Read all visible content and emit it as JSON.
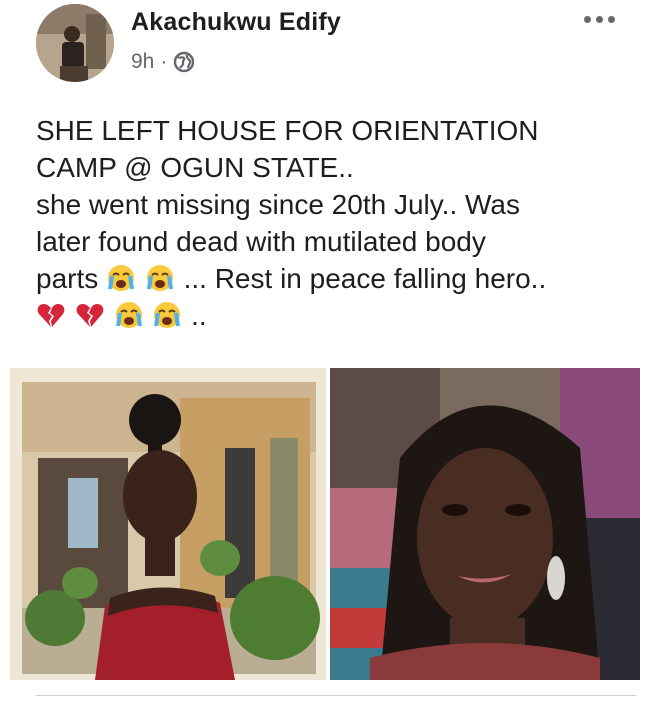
{
  "post": {
    "author": "Akachukwu Edify",
    "time": "9h",
    "separator": "·",
    "privacy_icon": "globe-icon",
    "more_icon": "more-options-icon",
    "text_lines": [
      "SHE LEFT HOUSE FOR ORIENTATION",
      "CAMP @ OGUN STATE..",
      "she went missing since 20th July.. Was",
      "later found dead with mutilated body",
      "parts",
      "... Rest in peace falling hero..",
      ".."
    ],
    "emojis": {
      "crying": "loudly-crying-face",
      "broken_heart": "broken-heart"
    },
    "photos": [
      {
        "icon": "photo-woman-red-dress"
      },
      {
        "icon": "photo-woman-selfie"
      }
    ]
  }
}
